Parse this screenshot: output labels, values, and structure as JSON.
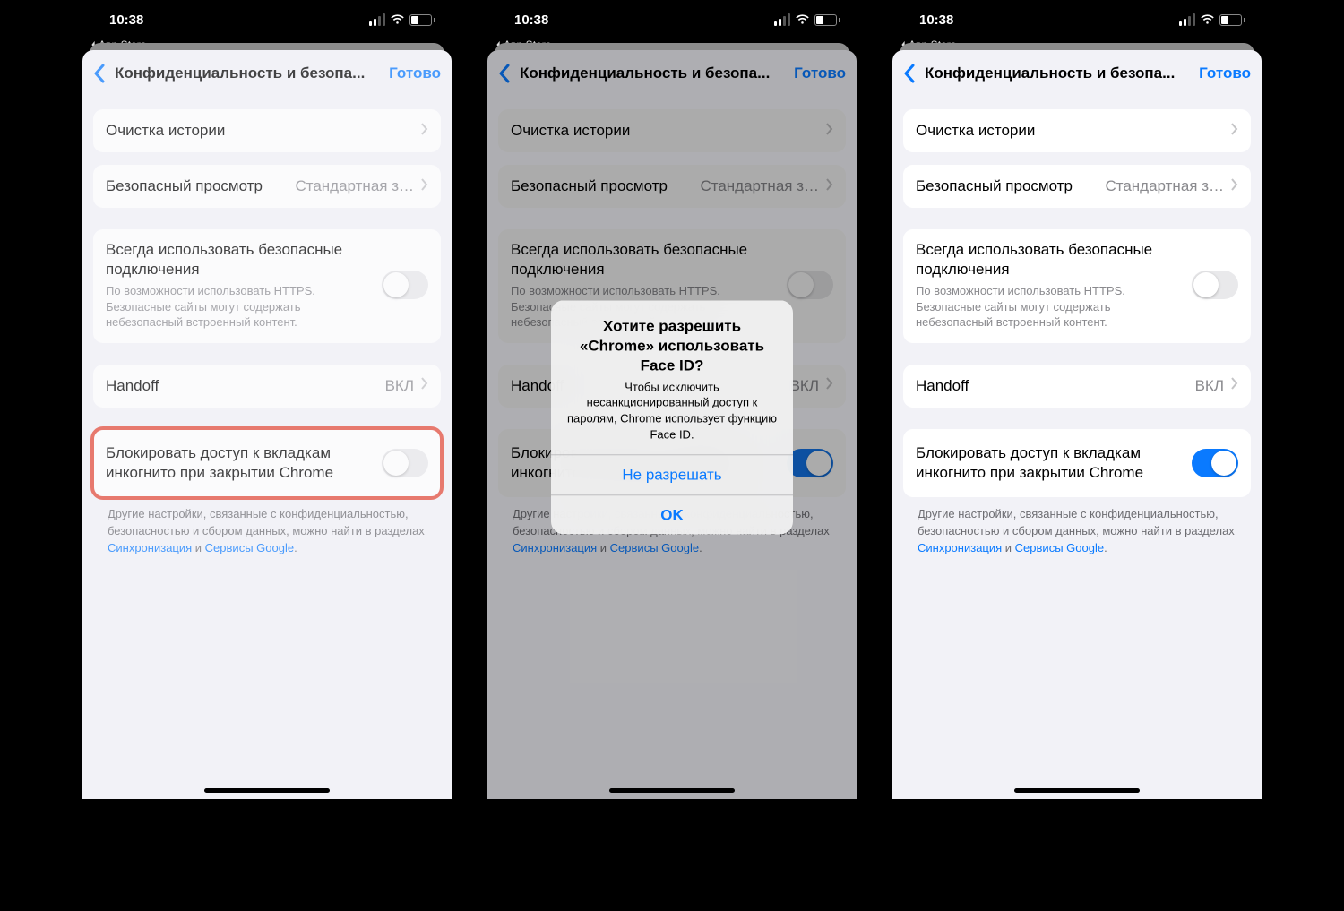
{
  "status": {
    "time": "10:38",
    "back_app": "App Store",
    "battery": "40"
  },
  "nav": {
    "title": "Конфиденциальность и безопа...",
    "done": "Готово"
  },
  "rows": {
    "clear": "Очистка истории",
    "safe_browsing": "Безопасный просмотр",
    "safe_browsing_value": "Стандартная з…",
    "https_title": "Всегда использовать безопасные подключения",
    "https_desc": "По возможности использовать HTTPS. Безопасные сайты могут содержать небезопасный встроенный контент.",
    "handoff": "Handoff",
    "handoff_value": "ВКЛ",
    "lock": "Блокировать доступ к вкладкам инкогнито при закрытии Chrome"
  },
  "footer": {
    "text1": "Другие настройки, связанные с конфиденциальностью, безопасностью и сбором данных, можно найти в разделах ",
    "link1": "Синхронизация",
    "and": " и ",
    "link2": "Сервисы Google",
    "dot": "."
  },
  "alert": {
    "title": "Хотите разрешить «Chrome» использовать Face ID?",
    "message": "Чтобы исключить несанкционированный доступ к паролям, Chrome использует функцию Face ID.",
    "deny": "Не разрешать",
    "ok": "OK"
  }
}
